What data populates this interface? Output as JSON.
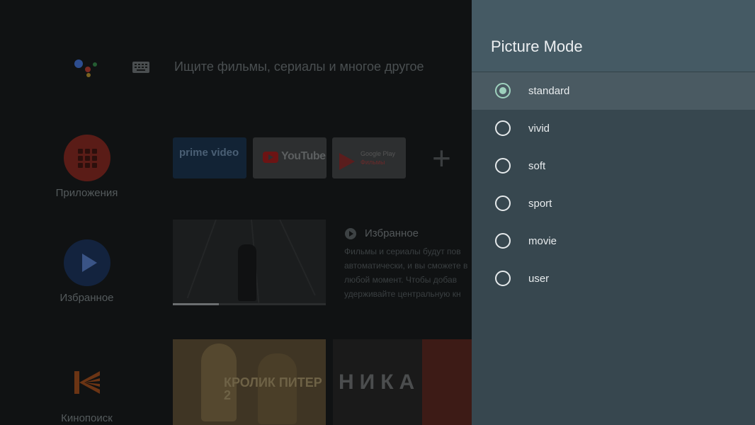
{
  "launcher": {
    "search_placeholder": "Ищите фильмы, сериалы и многое другое",
    "sidebar": [
      {
        "label": "Приложения"
      },
      {
        "label": "Избранное"
      },
      {
        "label": "Кинопоиск"
      }
    ],
    "apps_row": {
      "prime": "prime video",
      "youtube": "YouTube",
      "google_play_line1": "Google Play",
      "google_play_line2": "Фильмы",
      "add": "+"
    },
    "favorites": {
      "title": "Избранное",
      "description": "Фильмы и сериалы будут пов автоматически, и вы сможете в любой момент. Чтобы добав удерживайте центральную кн",
      "progress_fraction": 0.3
    },
    "cards": [
      {
        "title": "КРОЛИК ПИТЕР 2"
      },
      {
        "title": "НИКА"
      }
    ]
  },
  "panel": {
    "title": "Picture Mode",
    "selected": "standard",
    "options": [
      {
        "label": "standard",
        "checked": true
      },
      {
        "label": "vivid",
        "checked": false
      },
      {
        "label": "soft",
        "checked": false
      },
      {
        "label": "sport",
        "checked": false
      },
      {
        "label": "movie",
        "checked": false
      },
      {
        "label": "user",
        "checked": false
      }
    ],
    "accent_color": "#9ed1bd",
    "background_color": "#37474f",
    "header_color": "#455a64"
  }
}
